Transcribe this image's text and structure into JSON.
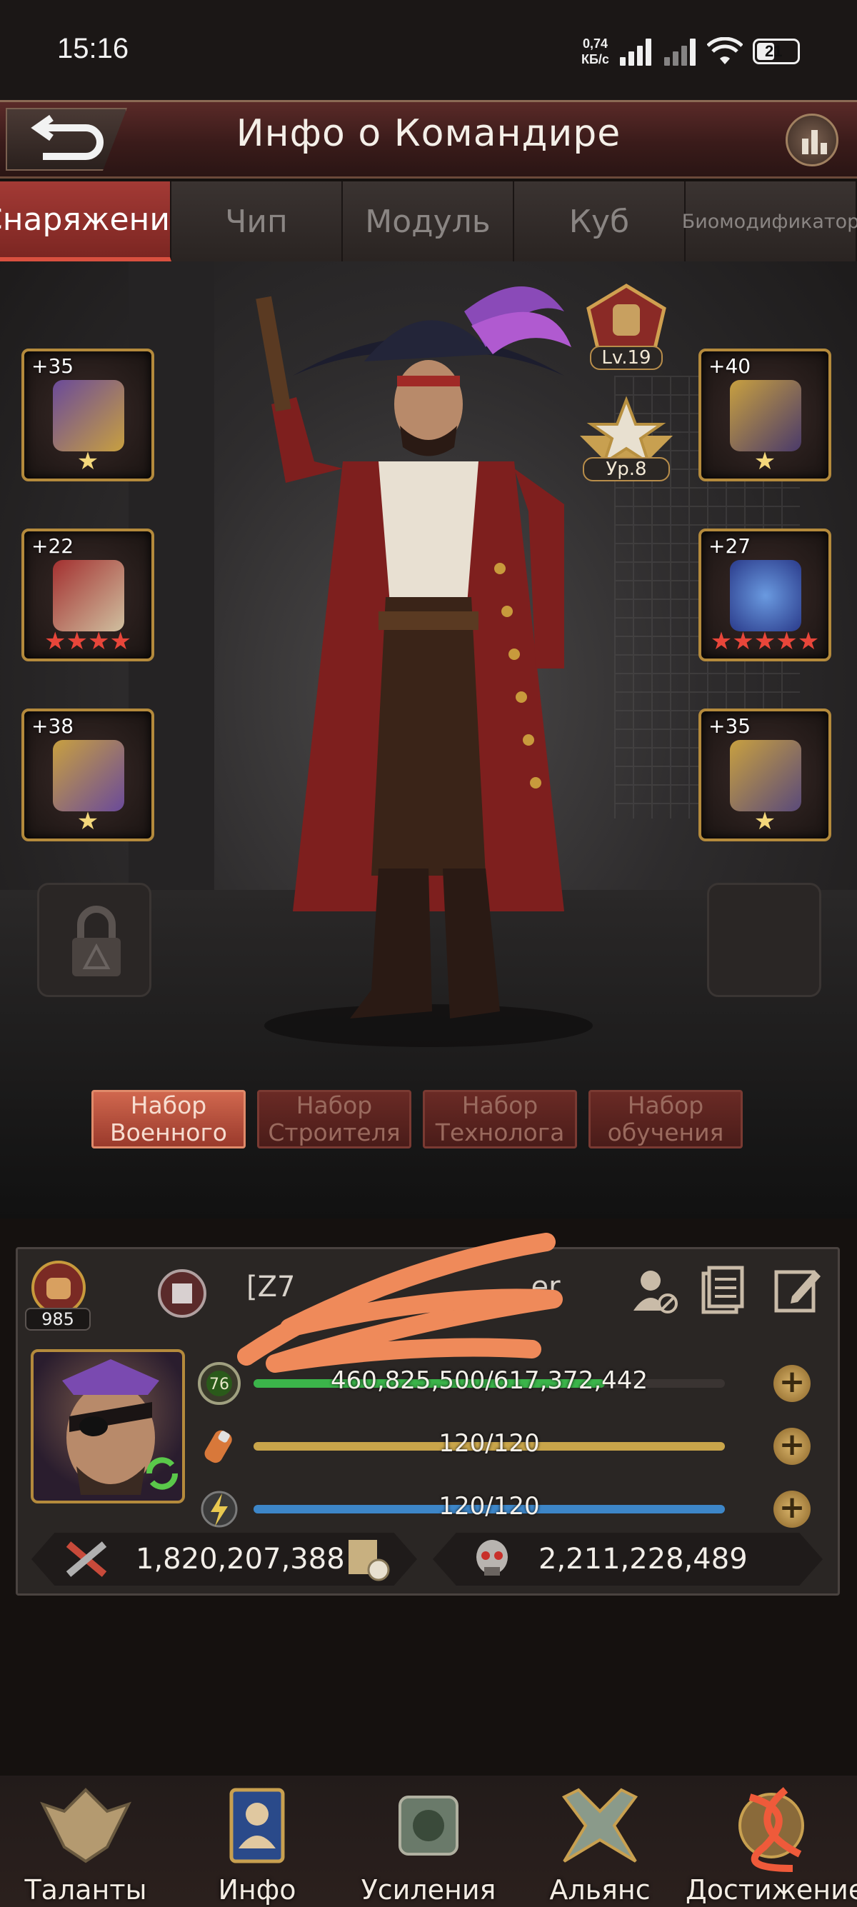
{
  "status_bar": {
    "time": "15:16",
    "net_speed_value": "0,74",
    "net_speed_unit": "КБ/с",
    "battery": "21"
  },
  "header": {
    "title": "Инфо о Командире"
  },
  "tabs": [
    {
      "label": "Снаряжение",
      "active": true
    },
    {
      "label": "Чип",
      "active": false
    },
    {
      "label": "Модуль",
      "active": false
    },
    {
      "label": "Куб",
      "active": false
    },
    {
      "label": "Биомодификатор",
      "active": false
    }
  ],
  "equipment": {
    "left": [
      {
        "level": "+35",
        "stars": "★",
        "star_color": "gold"
      },
      {
        "level": "+22",
        "stars": "★★★★",
        "star_color": "red"
      },
      {
        "level": "+38",
        "stars": "★",
        "star_color": "gold"
      }
    ],
    "right": [
      {
        "level": "+40",
        "stars": "★",
        "star_color": "gold"
      },
      {
        "level": "+27",
        "stars": "★★★★★",
        "star_color": "red"
      },
      {
        "level": "+35",
        "stars": "★",
        "star_color": "gold"
      }
    ],
    "badges": {
      "military_level": "Lv.19",
      "rank_level": "Ур.8"
    }
  },
  "sets": [
    {
      "line1": "Набор",
      "line2": "Военного",
      "active": true
    },
    {
      "line1": "Набор",
      "line2": "Строителя",
      "active": false
    },
    {
      "line1": "Набор",
      "line2": "Технолога",
      "active": false
    },
    {
      "line1": "Набор",
      "line2": "обучения",
      "active": false
    }
  ],
  "commander": {
    "power_small": "985",
    "name_visible": "[Z7",
    "name_tail": "er",
    "level": "76",
    "experience": {
      "text": "460,825,500/617,372,442",
      "fraction": 0.746
    },
    "stamina": {
      "text": "120/120",
      "fraction": 1.0
    },
    "energy": {
      "text": "120/120",
      "fraction": 1.0
    },
    "power": "1,820,207,388",
    "kills": "2,211,228,489"
  },
  "bottom_nav": [
    {
      "label": "Таланты"
    },
    {
      "label": "Инфо"
    },
    {
      "label": "Усиления"
    },
    {
      "label": "Альянс"
    },
    {
      "label": "Достижение"
    }
  ],
  "colors": {
    "accent_red": "#a33a35",
    "gold": "#b48a3c",
    "exp_bar": "#3bb44a",
    "stamina_bar": "#c9a54a",
    "energy_bar": "#3d86c8",
    "scribble": "#ef8a5a"
  }
}
